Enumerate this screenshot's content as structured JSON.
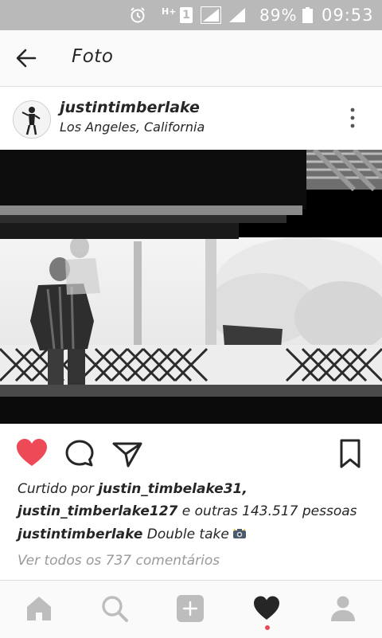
{
  "status_bar": {
    "network": "H+",
    "sim": "1",
    "battery_percent": "89%",
    "time": "09:53",
    "icons": [
      "alarm-icon",
      "signal-icon",
      "signal-icon",
      "battery-icon"
    ]
  },
  "header": {
    "title": "Foto",
    "back_icon": "arrow-left-icon"
  },
  "post": {
    "username": "justintimberlake",
    "location": "Los Angeles, California",
    "more_icon": "vertical-ellipsis-icon",
    "image_description_icon": "photo",
    "liked": true,
    "likes": {
      "prefix": "Curtido por ",
      "user1": "justin_timbelake31,",
      "user2": "justin_timberlake127",
      "suffix": " e outras 143.517 pessoas"
    },
    "caption": {
      "username": "justintimberlake",
      "text": " Double take"
    },
    "view_comments": "Ver todos os 737 comentários"
  },
  "colors": {
    "like_red": "#ed4956",
    "status_bar_bg": "#b9b9b9",
    "muted_text": "#999999",
    "activity_dot": "#ed4956"
  },
  "bottom_nav": {
    "items": [
      "home-icon",
      "search-icon",
      "add-icon",
      "heart-icon",
      "profile-icon"
    ],
    "active": "heart-icon"
  }
}
